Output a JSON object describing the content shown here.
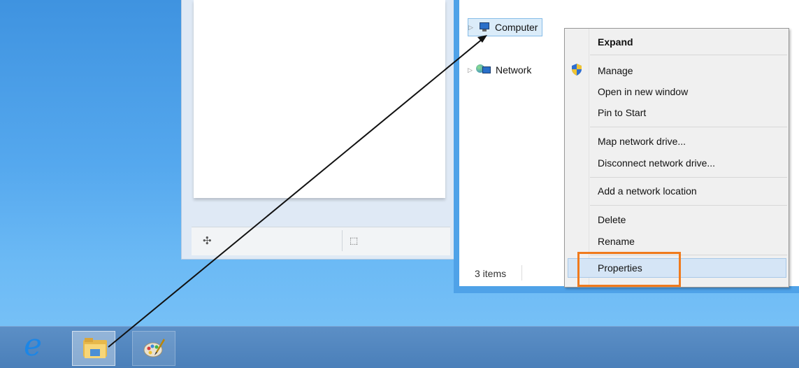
{
  "explorer": {
    "tree": [
      {
        "label": "Computer",
        "selected": true
      },
      {
        "label": "Network",
        "selected": false
      }
    ],
    "status": "3 items"
  },
  "context_menu": {
    "items": [
      {
        "label": "Expand",
        "bold": true
      },
      {
        "label": "Manage"
      },
      {
        "label": "Open in new window"
      },
      {
        "label": "Pin to Start"
      },
      {
        "label": "Map network drive..."
      },
      {
        "label": "Disconnect network drive..."
      },
      {
        "label": "Add a network location"
      },
      {
        "label": "Delete"
      },
      {
        "label": "Rename"
      },
      {
        "label": "Properties",
        "highlighted": true
      }
    ]
  },
  "taskbar": {
    "apps": [
      {
        "icon": "internet-explorer-icon"
      },
      {
        "icon": "file-explorer-icon",
        "active": true
      },
      {
        "icon": "paint-icon"
      }
    ]
  },
  "colors": {
    "desktop": "#55a8ee",
    "highlight_box": "#f07a1c",
    "taskbar": "#4a7fb9"
  }
}
